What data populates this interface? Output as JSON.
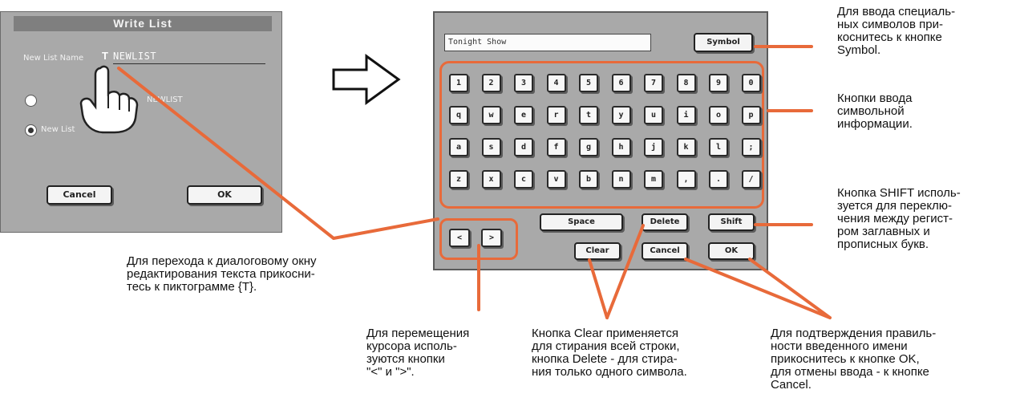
{
  "write_list": {
    "title": "Write List",
    "name_label": "New List Name",
    "text_icon": "T",
    "name_value": "NEWLIST",
    "radio_existing_label": "NEWLIST",
    "radio_new_label": "New List",
    "cancel_label": "Cancel",
    "ok_label": "OK"
  },
  "arrow_icon": "right-arrow-icon",
  "keyboard": {
    "input_value": "Tonight Show",
    "symbol_label": "Symbol",
    "rows": [
      [
        "1",
        "2",
        "3",
        "4",
        "5",
        "6",
        "7",
        "8",
        "9",
        "0"
      ],
      [
        "q",
        "w",
        "e",
        "r",
        "t",
        "y",
        "u",
        "i",
        "o",
        "p"
      ],
      [
        "a",
        "s",
        "d",
        "f",
        "g",
        "h",
        "j",
        "k",
        "l",
        ";"
      ],
      [
        "z",
        "x",
        "c",
        "v",
        "b",
        "n",
        "m",
        ",",
        ".",
        "/"
      ]
    ],
    "left_label": "<",
    "right_label": ">",
    "space_label": "Space",
    "delete_label": "Delete",
    "shift_label": "Shift",
    "clear_label": "Clear",
    "cancel_label": "Cancel",
    "ok_label": "OK"
  },
  "annotations": {
    "symbol_note": "Для ввода специаль-\nных символов при-\nкоснитесь к кнопке\nSymbol.",
    "keys_note": "Кнопки ввода\nсимвольной\nинформации.",
    "shift_note": "Кнопка SHIFT исполь-\nзуется для переклю-\nчения между регист-\nром заглавных и\nпрописных букв.",
    "t_icon_note": "Для перехода к диалоговому окну\nредактирования текста прикосни-\nтесь к пиктограмме {T}.",
    "cursor_note": "Для перемещения\nкурсора исполь-\nзуются кнопки\n\"<\" и \">\".",
    "clear_note": "Кнопка Clear применяется\nдля стирания всей строки,\nкнопка Delete - для стира-\nния только одного символа.",
    "ok_note": "Для подтверждения правиль-\nности введенного имени\nприкоснитесь к кнопке OK,\nдля отмены ввода - к кнопке\nCancel."
  },
  "colors": {
    "callout": "#e86a3a",
    "dialog_bg": "#a9a9a9"
  }
}
